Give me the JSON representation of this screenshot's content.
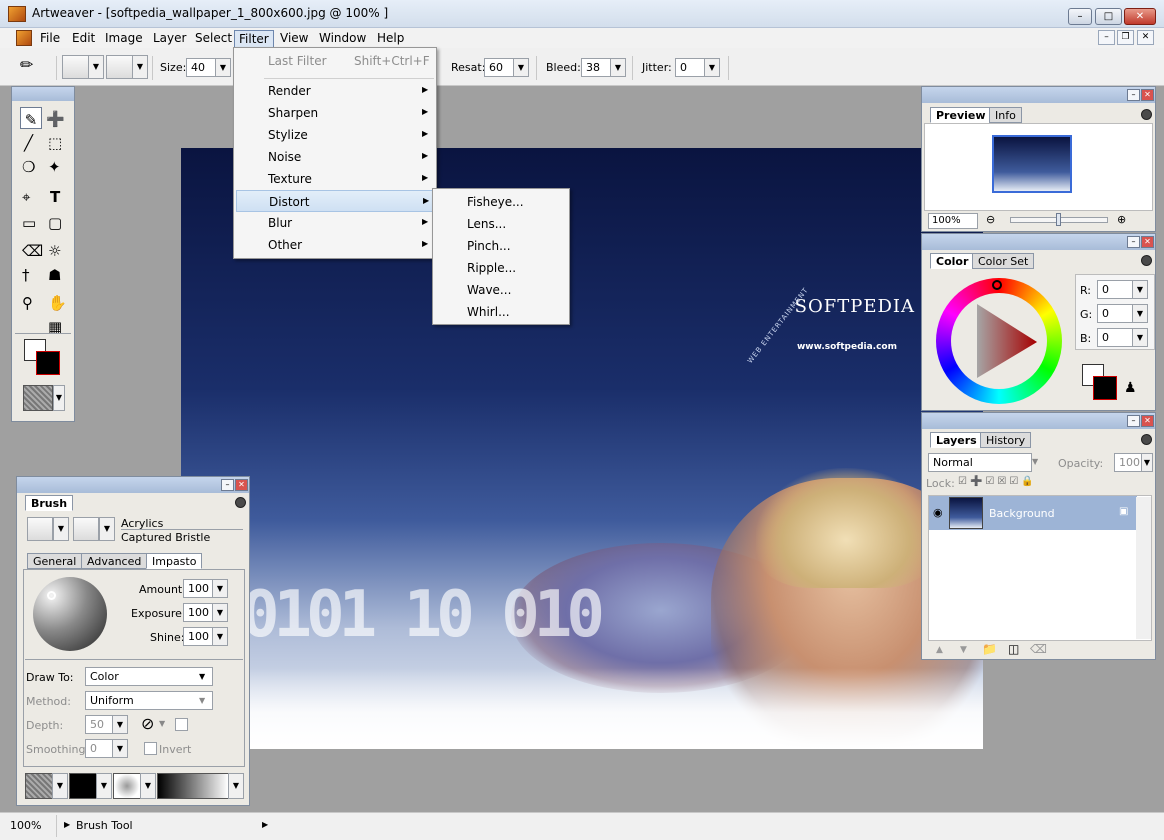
{
  "window": {
    "title": "Artweaver - [softpedia_wallpaper_1_800x600.jpg @ 100% ]"
  },
  "menubar": [
    "File",
    "Edit",
    "Image",
    "Layer",
    "Select",
    "Filter",
    "View",
    "Window",
    "Help"
  ],
  "toolbar": {
    "size_label": "Size:",
    "size_value": "40",
    "resat_label": "Resat:",
    "resat_value": "60",
    "bleed_label": "Bleed:",
    "bleed_value": "38",
    "jitter_label": "Jitter:",
    "jitter_value": "0"
  },
  "filter_menu": {
    "last_filter": "Last Filter",
    "last_filter_shortcut": "Shift+Ctrl+F",
    "items": [
      "Render",
      "Sharpen",
      "Stylize",
      "Noise",
      "Texture",
      "Distort",
      "Blur",
      "Other"
    ],
    "highlighted": "Distort"
  },
  "distort_submenu": [
    "Fisheye...",
    "Lens...",
    "Pinch...",
    "Ripple...",
    "Wave...",
    "Whirl..."
  ],
  "canvas": {
    "logo": "SOFTPEDIA",
    "url": "www.softpedia.com",
    "side_text": "WEB ENTERTAINMENT",
    "digits": "0101 10 010"
  },
  "preview_panel": {
    "tabs": [
      "Preview",
      "Info"
    ],
    "zoom": "100%"
  },
  "color_panel": {
    "tabs": [
      "Color",
      "Color Set"
    ],
    "r_label": "R:",
    "g_label": "G:",
    "b_label": "B:",
    "r": "0",
    "g": "0",
    "b": "0"
  },
  "layers_panel": {
    "tabs": [
      "Layers",
      "History"
    ],
    "blend_mode": "Normal",
    "opacity_label": "Opacity:",
    "opacity": "100",
    "lock_label": "Lock:",
    "layers": [
      {
        "name": "Background"
      }
    ]
  },
  "brush_panel": {
    "tab": "Brush",
    "category": "Acrylics",
    "variant": "Captured Bristle",
    "subtabs": [
      "General",
      "Advanced",
      "Impasto"
    ],
    "amount_label": "Amount:",
    "amount": "100",
    "exposure_label": "Exposure:",
    "exposure": "100",
    "shine_label": "Shine:",
    "shine": "100",
    "draw_to_label": "Draw To:",
    "draw_to": "Color",
    "method_label": "Method:",
    "method": "Uniform",
    "depth_label": "Depth:",
    "depth": "50",
    "smoothing_label": "Smoothing:",
    "smoothing": "0",
    "invert_label": "Invert"
  },
  "statusbar": {
    "zoom": "100%",
    "tool": "Brush Tool"
  }
}
